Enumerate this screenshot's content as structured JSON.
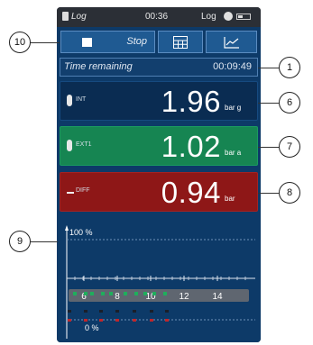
{
  "status": {
    "left_label": "Log",
    "time": "00:36",
    "right_label": "Log"
  },
  "toolbar": {
    "stop_label": "Stop"
  },
  "time_remaining": {
    "label": "Time remaining",
    "value": "00:09:49"
  },
  "readings": [
    {
      "tag": "INT",
      "value": "1.96",
      "unit": "bar g"
    },
    {
      "tag": "EXT1",
      "value": "1.02",
      "unit": "bar a"
    },
    {
      "tag": "DIFF",
      "value": "0.94",
      "unit": "bar"
    }
  ],
  "chart_data": {
    "type": "line",
    "x_ticks": [
      "6",
      "8",
      "10",
      "12",
      "14"
    ],
    "y_top_label": "100 %",
    "y_bottom_label": "0 %"
  },
  "callouts": [
    "10",
    "1",
    "6",
    "7",
    "8",
    "9"
  ],
  "colors": {
    "int": "#0a2c52",
    "ext": "#168552",
    "diff": "#8e1717",
    "background": "#0d3a68"
  }
}
